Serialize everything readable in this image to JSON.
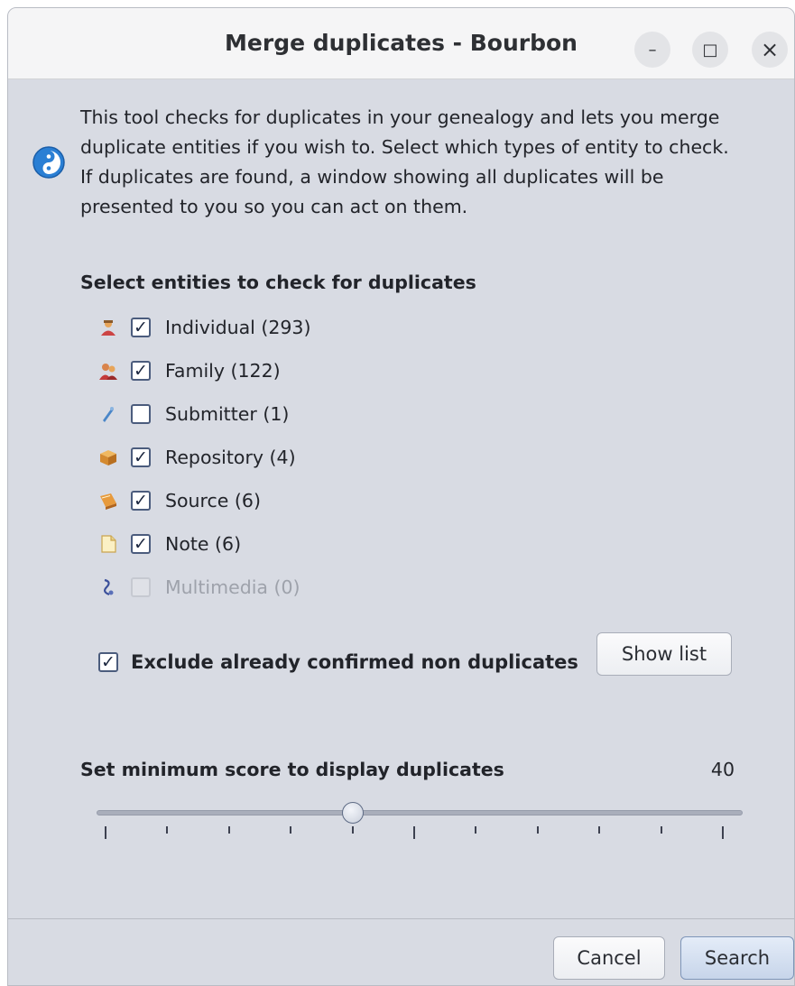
{
  "window": {
    "title": "Merge duplicates - Bourbon",
    "minimize_label": "–",
    "maximize_label": "□",
    "close_label": "×"
  },
  "intro": {
    "lines": [
      "This tool checks for duplicates in your genealogy and lets you merge",
      "duplicate entities if you wish to. Select which types of entity to check.",
      "If duplicates are found, a window showing all duplicates will be",
      "presented to you so you can act on them."
    ]
  },
  "entities": {
    "title": "Select entities to check for duplicates",
    "items": [
      {
        "label": "Individual (293)",
        "checked": true,
        "enabled": true,
        "icon": "individual-icon"
      },
      {
        "label": "Family (122)",
        "checked": true,
        "enabled": true,
        "icon": "family-icon"
      },
      {
        "label": "Submitter (1)",
        "checked": false,
        "enabled": true,
        "icon": "submitter-icon"
      },
      {
        "label": "Repository (4)",
        "checked": true,
        "enabled": true,
        "icon": "repository-icon"
      },
      {
        "label": "Source (6)",
        "checked": true,
        "enabled": true,
        "icon": "source-icon"
      },
      {
        "label": "Note (6)",
        "checked": true,
        "enabled": true,
        "icon": "note-icon"
      },
      {
        "label": "Multimedia (0)",
        "checked": false,
        "enabled": false,
        "icon": "multimedia-icon"
      }
    ]
  },
  "exclude": {
    "label": "Exclude already confirmed non duplicates",
    "checked": true,
    "show_list_label": "Show list"
  },
  "score": {
    "label": "Set minimum score to display duplicates",
    "value": "40",
    "slider_fraction": 0.4
  },
  "footer": {
    "cancel_label": "Cancel",
    "search_label": "Search"
  },
  "colors": {
    "dialog_bg": "#d8dbe3",
    "titlebar_bg": "#f5f5f6",
    "primary_button": "#c7d5ea"
  }
}
